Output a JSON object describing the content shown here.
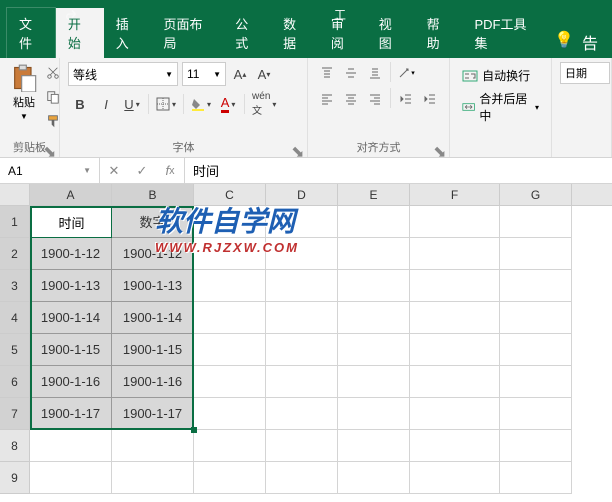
{
  "titlebar": {
    "title": "工"
  },
  "tabs": {
    "file": "文件",
    "home": "开始",
    "insert": "插入",
    "layout": "页面布局",
    "formula": "公式",
    "data": "数据",
    "review": "审阅",
    "view": "视图",
    "help": "帮助",
    "pdf": "PDF工具集"
  },
  "ribbon": {
    "paste": "粘贴",
    "clipboard": "剪贴板",
    "font_name": "等线",
    "font_size": "11",
    "font_label": "字体",
    "align_label": "对齐方式",
    "wrap_text": "自动换行",
    "merge_center": "合并后居中",
    "number_format": "日期"
  },
  "name_box": "A1",
  "formula_value": "时间",
  "columns": [
    "A",
    "B",
    "C",
    "D",
    "E",
    "F",
    "G"
  ],
  "rows": [
    "1",
    "2",
    "3",
    "4",
    "5",
    "6",
    "7",
    "8",
    "9"
  ],
  "cells": {
    "headers": [
      "时间",
      "数字"
    ],
    "data": [
      [
        "1900-1-12",
        "1900-1-12"
      ],
      [
        "1900-1-13",
        "1900-1-13"
      ],
      [
        "1900-1-14",
        "1900-1-14"
      ],
      [
        "1900-1-15",
        "1900-1-15"
      ],
      [
        "1900-1-16",
        "1900-1-16"
      ],
      [
        "1900-1-17",
        "1900-1-17"
      ]
    ]
  },
  "watermark": {
    "main": "软件自学网",
    "sub": "WWW.RJZXW.COM"
  }
}
